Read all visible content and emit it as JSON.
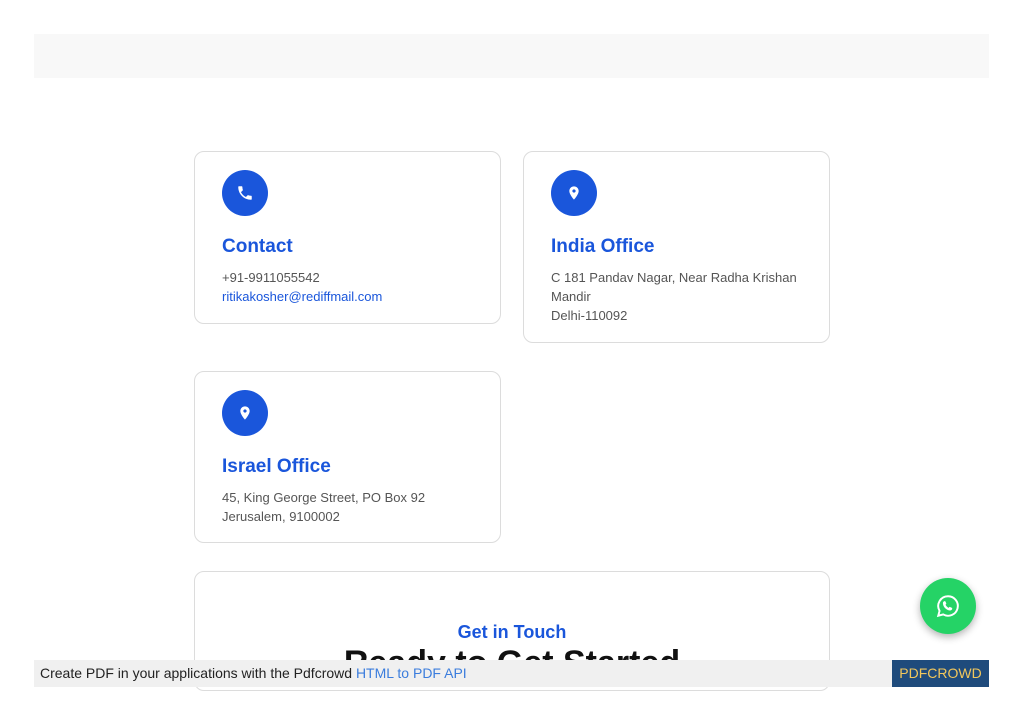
{
  "colors": {
    "accent": "#1a56db",
    "whatsapp": "#25d366",
    "pdf_brand_bg": "#1f4b7c",
    "pdf_brand_text": "#f2c75c"
  },
  "cards": {
    "contact": {
      "icon": "phone-icon",
      "title": "Contact",
      "phone": "+91-9911055542",
      "email": "ritikakosher@rediffmail.com"
    },
    "india": {
      "icon": "map-pin-icon",
      "title": "India Office",
      "address_line1": "C 181 Pandav Nagar, Near Radha Krishan",
      "address_line2": "Mandir",
      "address_line3": "Delhi-110092"
    },
    "israel": {
      "icon": "map-pin-icon",
      "title": "Israel Office",
      "address_line1": "45, King George Street, PO Box 92",
      "address_line2": "Jerusalem, 9100002"
    }
  },
  "get_in_touch": {
    "eyebrow": "Get in Touch",
    "heading": "Ready to Get Started"
  },
  "pdf_bar": {
    "message": "Create PDF in your applications with the Pdfcrowd ",
    "link": "HTML to PDF API",
    "brand": "PDFCROWD"
  },
  "whatsapp": {
    "icon": "whatsapp-icon"
  }
}
